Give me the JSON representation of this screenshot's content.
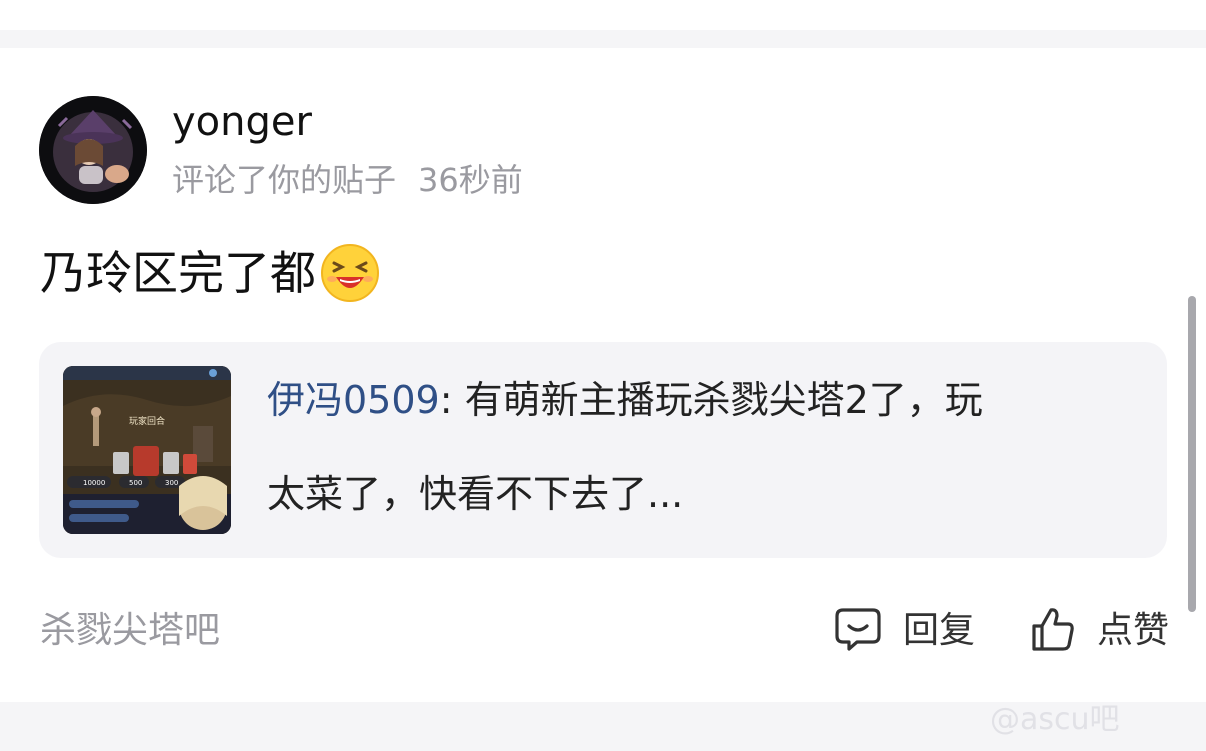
{
  "post": {
    "username": "yonger",
    "action": "评论了你的贴子",
    "time": "36秒前",
    "comment": "乃玲区完了都",
    "comment_emoji": "laughing-face-emoji"
  },
  "quote": {
    "author": "伊冯0509",
    "text_line1": ": 有萌新主播玩杀戮尖塔2了，玩",
    "text_line2": "太菜了，快看不下去了...",
    "thumbnail": {
      "caption": "玩家回合",
      "stat1": "10000",
      "stat2": "500",
      "stat3": "300"
    }
  },
  "footer": {
    "forum_tag": "杀戮尖塔吧",
    "reply_label": "回复",
    "like_label": "点赞"
  },
  "watermark": "@ascu吧",
  "colors": {
    "author_blue": "#2f4f86",
    "meta_gray": "#9a9aa0",
    "quote_bg": "#f4f4f7"
  }
}
